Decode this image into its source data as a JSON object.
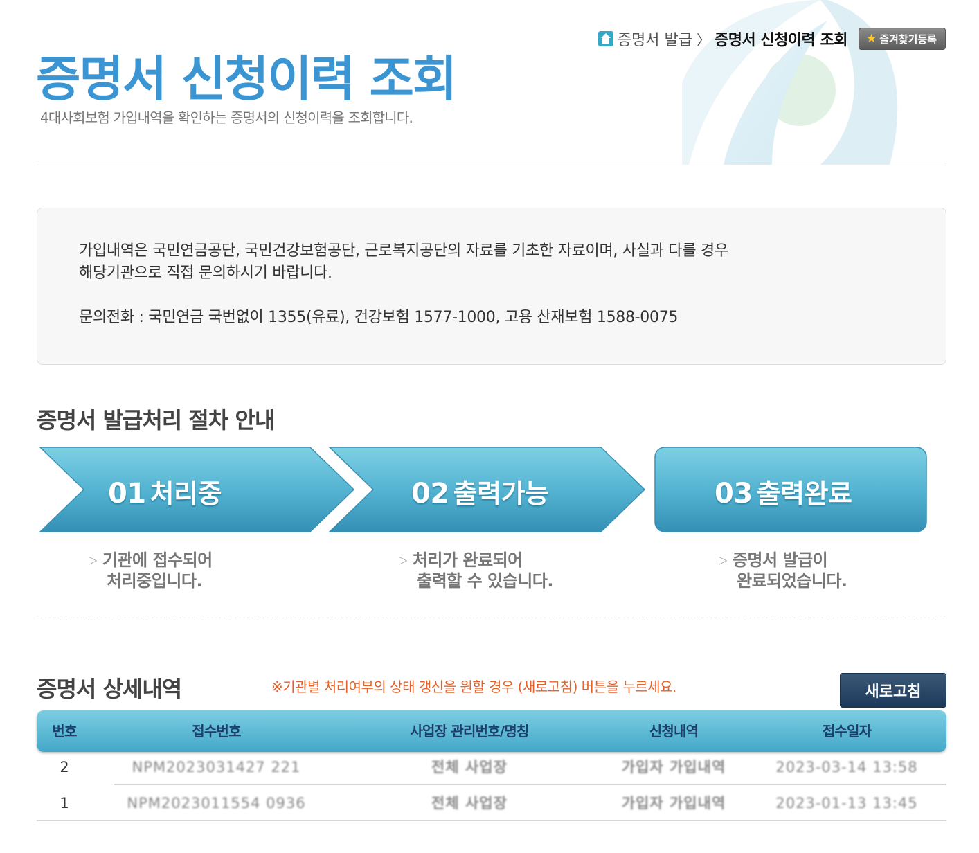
{
  "breadcrumb": {
    "parent": "증명서 발급",
    "separator": "〉",
    "current": "증명서 신청이력 조회",
    "favorite_label": "즐겨찾기등록"
  },
  "header": {
    "title": "증명서 신청이력 조회",
    "subtitle": "4대사회보험 가입내역을 확인하는 증명서의 신청이력을 조회합니다."
  },
  "info": {
    "line1": "가입내역은 국민연금공단, 국민건강보험공단, 근로복지공단의 자료를 기초한 자료이며, 사실과 다를 경우",
    "line2": "해당기관으로 직접 문의하시기 바랍니다.",
    "phone": "문의전화 : 국민연금 국번없이 1355(유료), 건강보험 1577-1000, 고용 산재보험 1588-0075"
  },
  "process": {
    "title": "증명서 발급처리 절차 안내",
    "steps": [
      {
        "num": "01",
        "label": "처리중",
        "desc1": "기관에 접수되어",
        "desc2": "처리중입니다."
      },
      {
        "num": "02",
        "label": "출력가능",
        "desc1": "처리가 완료되어",
        "desc2": "출력할 수 있습니다."
      },
      {
        "num": "03",
        "label": "출력완료",
        "desc1": "증명서 발급이",
        "desc2": "완료되었습니다."
      }
    ],
    "colors": {
      "arrow_top": "#6cc6dd",
      "arrow_bottom": "#3797bb"
    }
  },
  "detail": {
    "title": "증명서 상세내역",
    "notice": "※기관별 처리여부의 상태 갱신을 원할 경우 (새로고침) 버튼을 누르세요.",
    "refresh_label": "새로고침",
    "columns": [
      "번호",
      "접수번호",
      "사업장 관리번호/명칭",
      "신청내역",
      "접수일자"
    ],
    "rows": [
      {
        "no": "2",
        "receipt": "NPM2023031427 221",
        "workplace": "전체 사업장",
        "request": "가입자 가입내역",
        "date": "2023-03-14 13:58"
      },
      {
        "no": "1",
        "receipt": "NPM2023011554 0936",
        "workplace": "전체 사업장",
        "request": "가입자 가입내역",
        "date": "2023-01-13 13:45"
      }
    ]
  }
}
